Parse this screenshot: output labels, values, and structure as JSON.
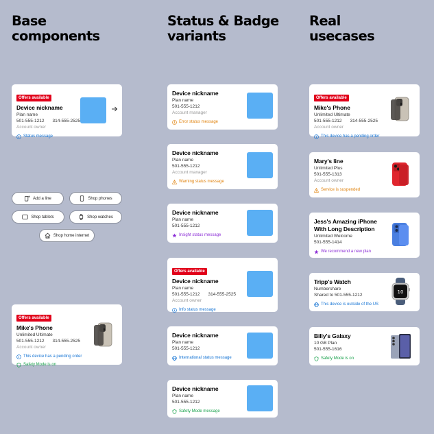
{
  "headings": {
    "base": [
      "Base",
      "components"
    ],
    "status": [
      "Status & Badge",
      "variants"
    ],
    "real": [
      "Real",
      "usecases"
    ]
  },
  "colors": {
    "background": "#b5bbcd",
    "badge": "#e1001a",
    "placeholder": "#5aaff4",
    "info": "#1574d4",
    "error": "#e0820c",
    "warning": "#e0820c",
    "insight": "#8b2cd6",
    "success": "#18a14b"
  },
  "base": {
    "card1": {
      "badge": "Offers available",
      "title": "Device nickname",
      "plan": "Plan name",
      "num1": "501-555-1212",
      "num2": "314-555-2525",
      "role": "Account owner",
      "status": "Status message",
      "status_icon": "info-icon",
      "arrow_icon": "arrow-right-icon"
    },
    "pills": [
      {
        "label": "Add a line",
        "icon": "add-device-icon"
      },
      {
        "label": "Shop phones",
        "icon": "phone-icon"
      },
      {
        "label": "Shop tablets",
        "icon": "tablet-icon"
      },
      {
        "label": "Shop watches",
        "icon": "watch-icon"
      },
      {
        "label": "Shop home internet",
        "icon": "home-icon"
      }
    ],
    "card2": {
      "badge": "Offers available",
      "title": "Mike's Phone",
      "plan": "Unlimited Ultimate",
      "num1": "501-555-1212",
      "num2": "314-555-2525",
      "role": "Account owner",
      "status1": "This device has a pending order",
      "status2": "Safety Mode is on"
    }
  },
  "variants": [
    {
      "title": "Device nickname",
      "plan": "Plan name",
      "num1": "501-555-1212",
      "role": "Account manager",
      "status": "Error status message",
      "kind": "error"
    },
    {
      "title": "Device nickname",
      "plan": "Plan name",
      "num1": "501-555-1212",
      "role": "Account manager",
      "status": "Warning status message",
      "kind": "warning"
    },
    {
      "title": "Device nickname",
      "plan": "Plan name",
      "num1": "501-555-1212",
      "status": "Insight status message",
      "kind": "insight"
    },
    {
      "badge": "Offers available",
      "title": "Device nickname",
      "plan": "Plan name",
      "num1": "501-555-1212",
      "num2": "314-555-2525",
      "role": "Account owner",
      "status": "Info status message",
      "kind": "info"
    },
    {
      "title": "Device nickname",
      "plan": "Plan name",
      "num1": "501-555-1212",
      "status": "International status message",
      "kind": "international"
    },
    {
      "title": "Device nickname",
      "plan": "Plan name",
      "num1": "501-555-1212",
      "status": "Safety Mode message",
      "kind": "safety"
    }
  ],
  "usecases": [
    {
      "badge": "Offers available",
      "title": "Mike's Phone",
      "plan": "Unlimited Ultimate",
      "num1": "501-555-1212",
      "num2": "314-555-2525",
      "role": "Account owner",
      "status": "This device has a pending order",
      "kind": "info",
      "device": "titanium-phone"
    },
    {
      "title": "Mary's line",
      "plan": "Unlimited Plus",
      "num1": "501-555-1313",
      "role": "Account owner",
      "status": "Service is suspended",
      "kind": "error",
      "device": "red-phone"
    },
    {
      "title1": "Jess's Amazing iPhone",
      "title2": "With Long Description",
      "plan": "Unlimited Welcome",
      "num1": "501-555-1414",
      "status": "We recommend a new plan",
      "kind": "insight",
      "device": "blue-phone"
    },
    {
      "title": "Tripp's Watch",
      "plan": "Numbershare",
      "num1": "Shared to 501-555-1212",
      "status": "This device is outside of the US",
      "kind": "international",
      "device": "watch"
    },
    {
      "title": "Billy's Galaxy",
      "plan": "10 GB Plan",
      "num1": "501-555-1616",
      "status": "Safety Mode is on",
      "kind": "safety",
      "device": "galaxy-phone"
    }
  ]
}
